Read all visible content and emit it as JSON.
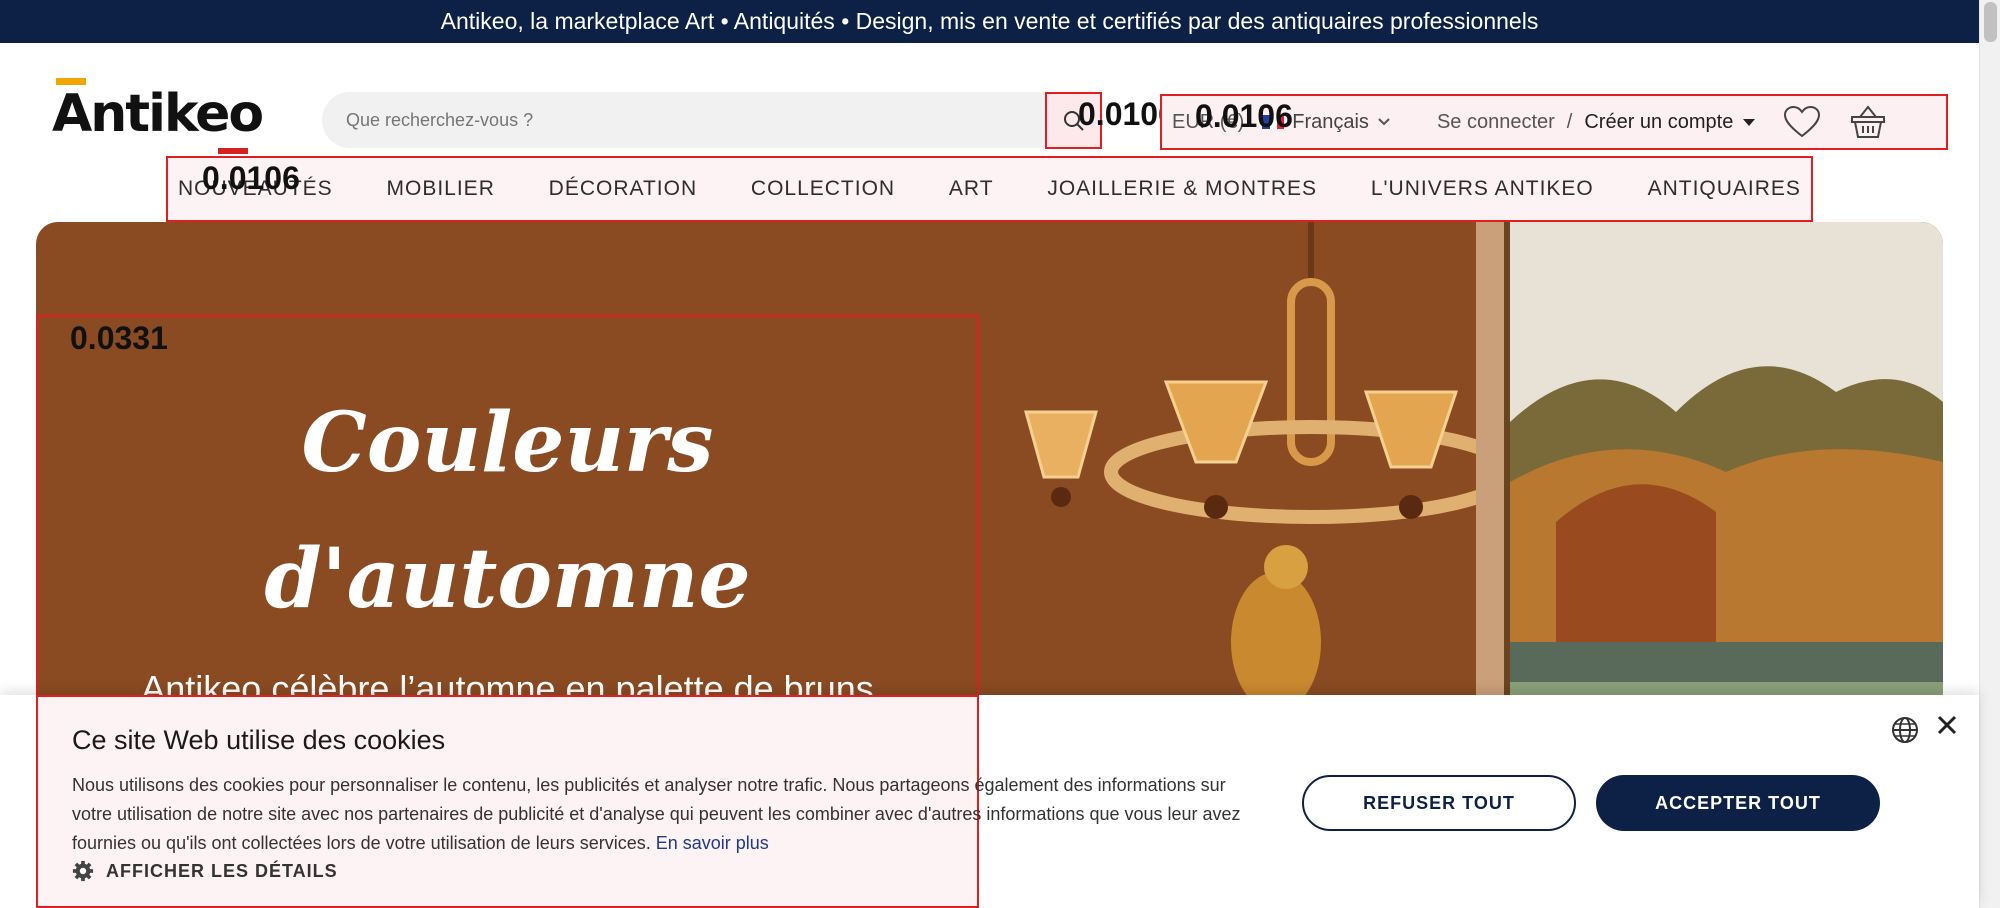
{
  "topbar": {
    "text": "Antikeo, la marketplace Art • Antiquités • Design, mis en vente et certifiés par des antiquaires professionnels"
  },
  "header": {
    "logo": "Antikeo",
    "search_placeholder": "Que recherchez-vous ?",
    "currency": "EUR (€)",
    "language": "Français",
    "login": "Se connecter",
    "separator": "/",
    "register": "Créer un compte"
  },
  "overlay_scores": {
    "search": "0.0106",
    "account": "0.0106",
    "nav": "0.0106",
    "hero": "0.0331"
  },
  "nav": {
    "items": [
      "NOUVEAUTÉS",
      "MOBILIER",
      "DÉCORATION",
      "COLLECTION",
      "ART",
      "JOAILLERIE & MONTRES",
      "L'UNIVERS ANTIKEO",
      "ANTIQUAIRES"
    ]
  },
  "hero": {
    "title_line1": "Couleurs",
    "title_line2": "d'automne",
    "subtitle": "Antikeo célèbre l’automne en palette de bruns"
  },
  "cookie": {
    "title": "Ce site Web utilise des cookies",
    "text": "Nous utilisons des cookies pour personnaliser le contenu, les publicités et analyser notre trafic. Nous partageons également des informations sur votre utilisation de notre site avec nos partenaires de publicité et d'analyse qui peuvent les combiner avec d'autres informations que vous leur avez fournies ou qu'ils ont collectées lors de votre utilisation de leurs services.",
    "link": "En savoir plus",
    "details": "AFFICHER LES DÉTAILS",
    "refuse": "REFUSER TOUT",
    "accept": "ACCEPTER TOUT"
  },
  "colors": {
    "brand_navy": "#0d2147",
    "hero_brown": "#8a4b22",
    "logo_accent": "#f0a500",
    "highlight_red": "#e02020"
  },
  "icons": [
    "search-icon",
    "flag-fr-icon",
    "chevron-down-icon",
    "caret-down-icon",
    "heart-icon",
    "basket-icon",
    "globe-icon",
    "close-icon",
    "gear-icon"
  ]
}
